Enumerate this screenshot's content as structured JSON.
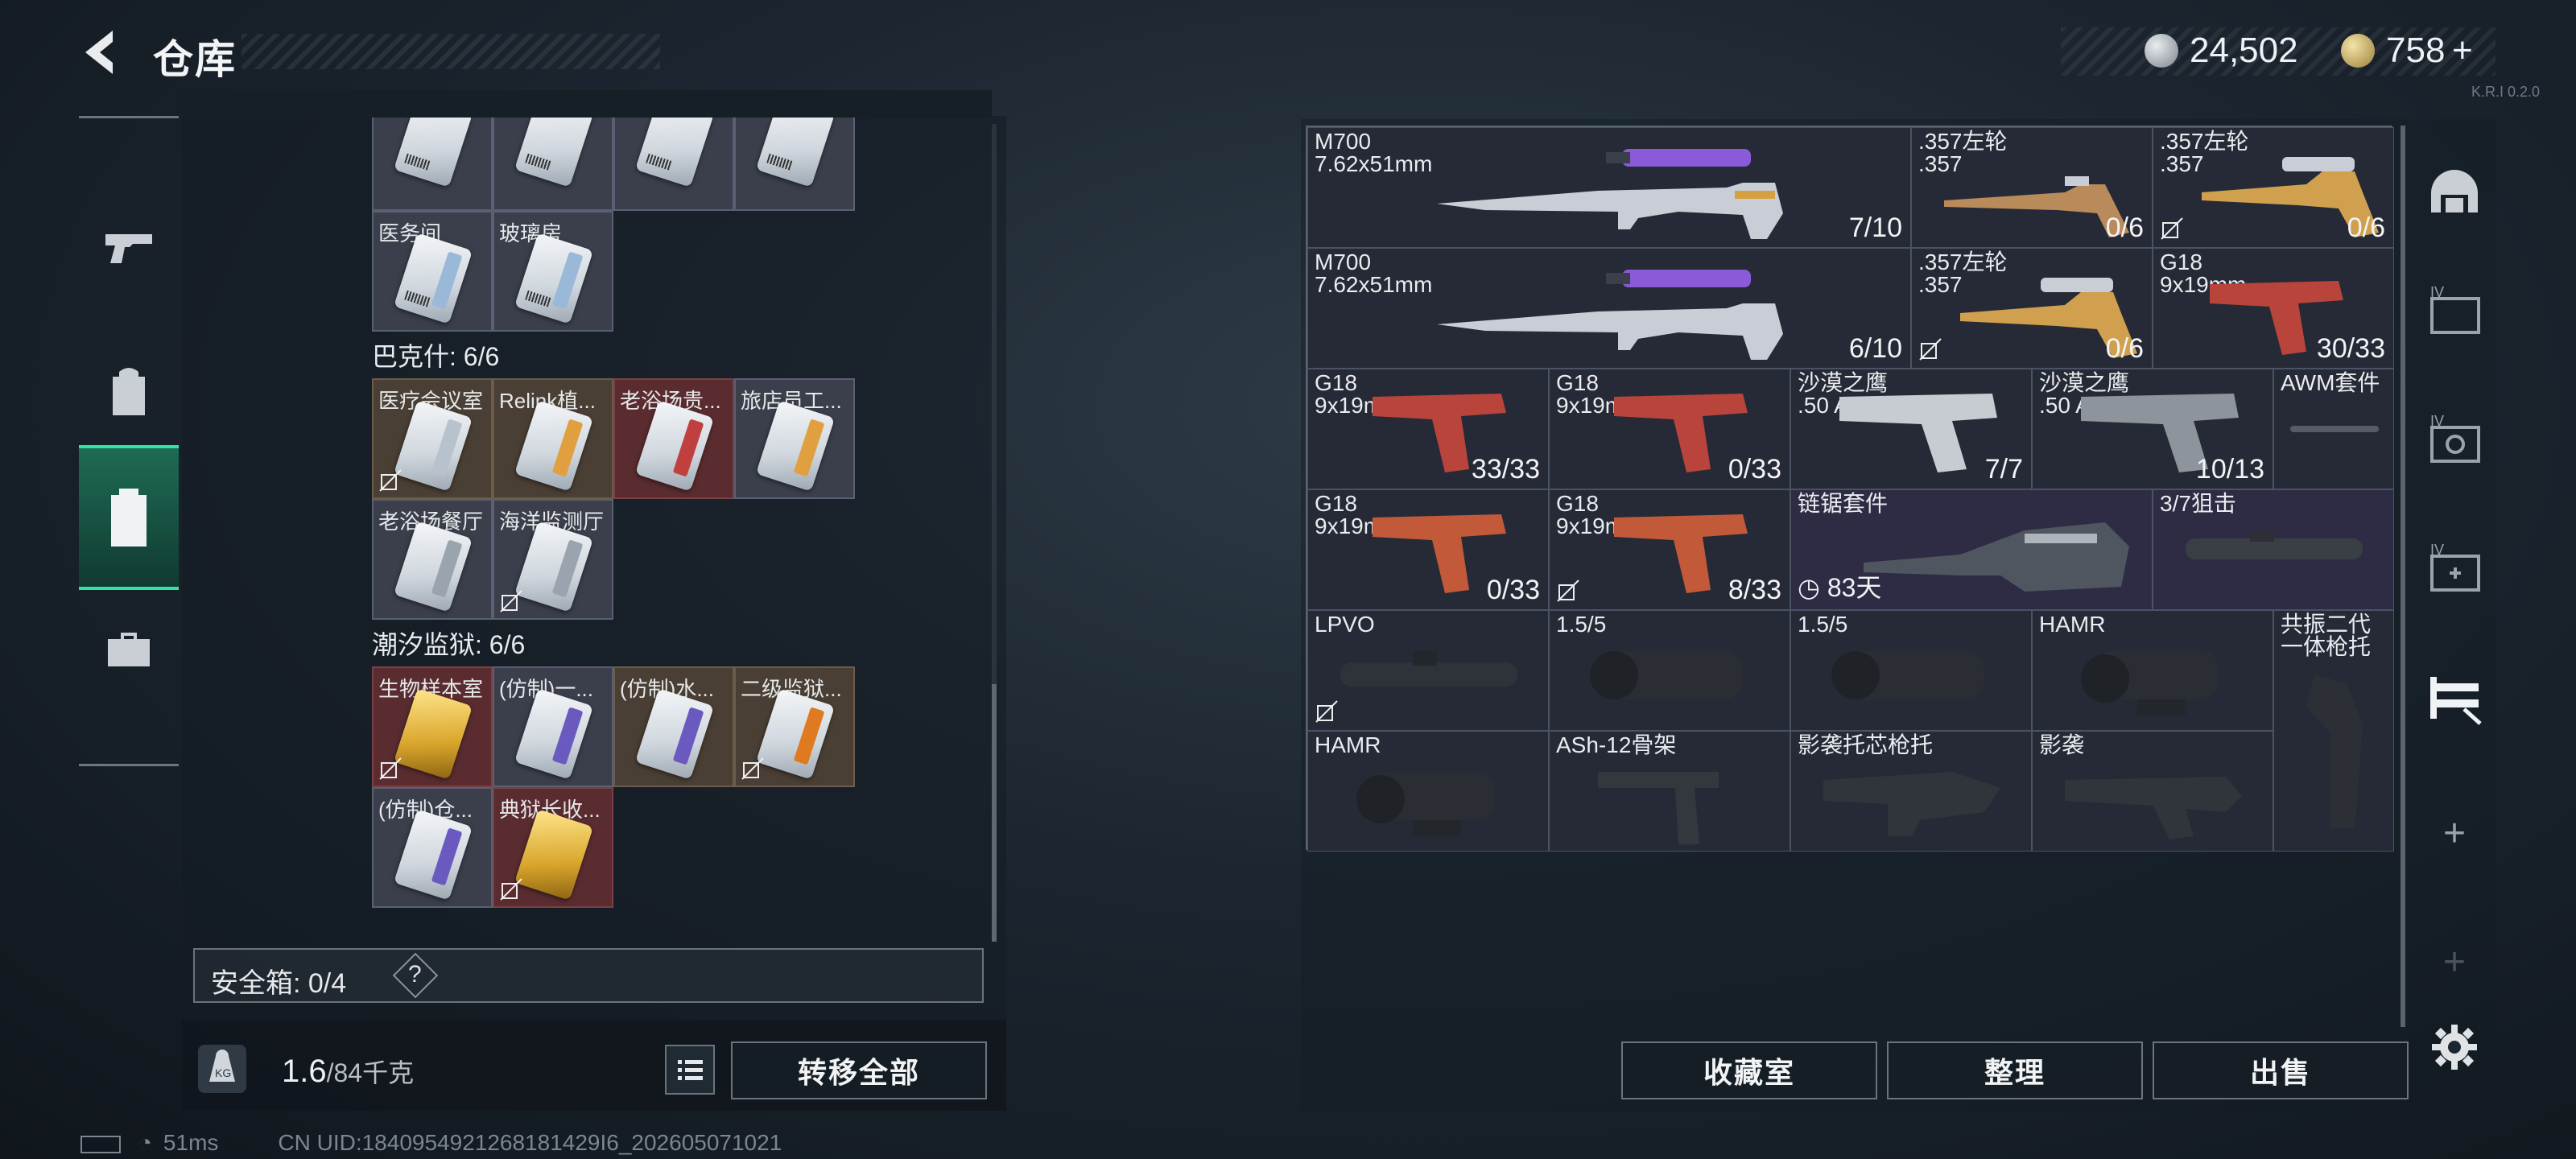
{
  "header": {
    "title": "仓库"
  },
  "currency": {
    "coins": "24,502",
    "premium": "758",
    "plus": "+",
    "small_text": "K.R.I 0.2.0"
  },
  "left_rail": {
    "icons": [
      "pistol-icon",
      "backpack-icon",
      "case-icon",
      "toolbox-icon"
    ]
  },
  "left": {
    "top_row_cards": [
      {
        "label": ""
      },
      {
        "label": ""
      },
      {
        "label": ""
      },
      {
        "label": ""
      }
    ],
    "row2_cards": [
      {
        "label": "医务间"
      },
      {
        "label": "玻璃房"
      }
    ],
    "section_a": {
      "title": "巴克什: 6/6",
      "cards": [
        {
          "label": "医疗会议室"
        },
        {
          "label": "Relink植..."
        },
        {
          "label": "老浴场贵..."
        },
        {
          "label": "旅店员工..."
        },
        {
          "label": "老浴场餐厅"
        },
        {
          "label": "海洋监测厅"
        }
      ]
    },
    "section_b": {
      "title": "潮汐监狱: 6/6",
      "cards": [
        {
          "label": "生物样本室"
        },
        {
          "label": "(仿制)一..."
        },
        {
          "label": "(仿制)水..."
        },
        {
          "label": "二级监狱..."
        },
        {
          "label": "(仿制)仓..."
        },
        {
          "label": "典狱长收..."
        }
      ]
    },
    "safebox": {
      "label": "安全箱: 0/4",
      "help": "?"
    },
    "weight": {
      "value": "1.6",
      "max": "/84千克"
    },
    "transfer_all": "转移全部"
  },
  "status_bar": {
    "ping": "51ms",
    "uid": "CN UID:1840954921268181429I6_202605071021"
  },
  "stash": {
    "items": [
      {
        "name": "M700",
        "sub": "7.62x51mm",
        "count": "7/10"
      },
      {
        "name": ".357左轮",
        "sub": ".357",
        "count": "0/6"
      },
      {
        "name": ".357左轮",
        "sub": ".357",
        "count": "0/6"
      },
      {
        "name": "M700",
        "sub": "7.62x51mm",
        "count": "6/10"
      },
      {
        "name": ".357左轮",
        "sub": ".357",
        "count": "0/6"
      },
      {
        "name": "G18",
        "sub": "9x19mm",
        "count": "30/33"
      },
      {
        "name": "G18",
        "sub": "9x19mm",
        "count": "33/33"
      },
      {
        "name": "G18",
        "sub": "9x19mm",
        "count": "0/33"
      },
      {
        "name": "沙漠之鹰",
        "sub": ".50 AE",
        "count": "7/7"
      },
      {
        "name": "沙漠之鹰",
        "sub": ".50 AE",
        "count": "10/13"
      },
      {
        "name": "AWM套件",
        "sub": "",
        "count": ""
      },
      {
        "name": "G18",
        "sub": "9x19mm",
        "count": "0/33"
      },
      {
        "name": "G18",
        "sub": "9x19mm",
        "count": "8/33"
      },
      {
        "name": "链锯套件",
        "sub": "",
        "count": "83天"
      },
      {
        "name": "3/7狙击",
        "sub": "",
        "count": ""
      },
      {
        "name": "LPVO",
        "sub": "",
        "count": ""
      },
      {
        "name": "1.5/5",
        "sub": "",
        "count": ""
      },
      {
        "name": "1.5/5",
        "sub": "",
        "count": ""
      },
      {
        "name": "HAMR",
        "sub": "",
        "count": ""
      },
      {
        "name": "共振二代",
        "sub": "一体枪托",
        "count": ""
      },
      {
        "name": "HAMR",
        "sub": "",
        "count": ""
      },
      {
        "name": "ASh-12骨架",
        "sub": "",
        "count": ""
      },
      {
        "name": "影袭托芯枪托",
        "sub": "",
        "count": ""
      },
      {
        "name": "影袭",
        "sub": "",
        "count": ""
      }
    ]
  },
  "buttons": {
    "collection": "收藏室",
    "sort": "整理",
    "sell": "出售"
  },
  "colors": {
    "accent": "#2ee3a3",
    "item_bg": "#2a2f3e",
    "card_bg": "#3a3d52"
  }
}
